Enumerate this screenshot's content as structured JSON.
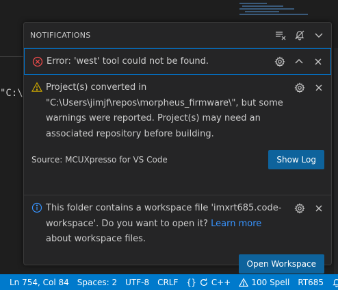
{
  "notifications": {
    "header_title": "NOTIFICATIONS",
    "items": [
      {
        "severity": "error",
        "message": "Error: 'west' tool could not be found."
      },
      {
        "severity": "warning",
        "message": "Project(s) converted in \"C:\\Users\\jimjf\\repos\\morpheus_firmware\\\", but some warnings were reported. Project(s) may need an associated repository before building.",
        "source": "Source: MCUXpresso for VS Code",
        "action_label": "Show Log"
      },
      {
        "severity": "info",
        "message_before": "This folder contains a workspace file 'imxrt685.code-workspace'. Do you want to open it? ",
        "link_text": "Learn more",
        "message_after": " about workspace files.",
        "action_label": "Open Workspace"
      }
    ]
  },
  "editor": {
    "visible_text": "\"C:\\"
  },
  "status_bar": {
    "position": "Ln 754, Col 84",
    "spaces": "Spaces: 2",
    "encoding": "UTF-8",
    "eol": "CRLF",
    "language": "C++",
    "problems": "100 Spell",
    "target": "RT685"
  },
  "colors": {
    "accent": "#007acc",
    "button": "#0e639c",
    "error": "#f14c4c",
    "warning": "#cca700",
    "info": "#3794ff",
    "focus_border": "#0078d4"
  }
}
